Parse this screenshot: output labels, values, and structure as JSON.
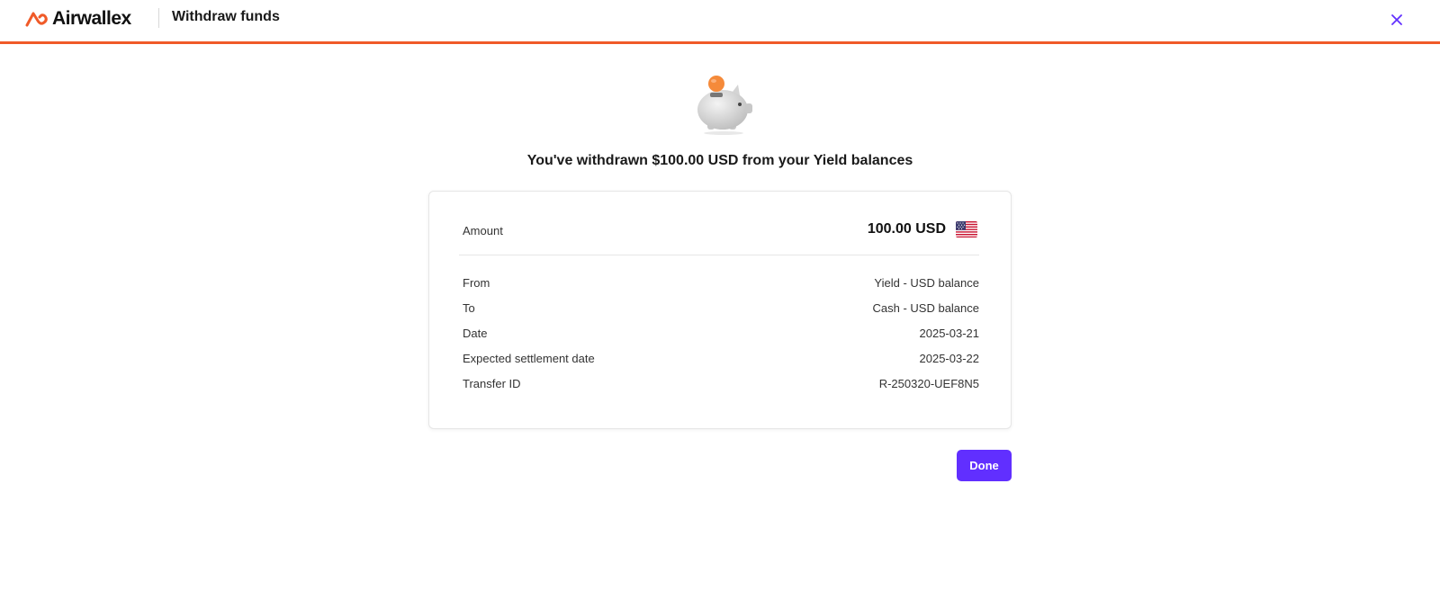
{
  "header": {
    "brand": "Airwallex",
    "title": "Withdraw funds",
    "accent_color": "#f05a28",
    "close_icon": "close-icon"
  },
  "confirmation": {
    "illustration": "piggy-bank-icon",
    "headline": "You've withdrawn $100.00 USD from your Yield balances"
  },
  "summary": {
    "amount_label": "Amount",
    "amount_value": "100.00 USD",
    "currency_flag": "us-flag-icon",
    "rows": [
      {
        "label": "From",
        "value": "Yield - USD balance"
      },
      {
        "label": "To",
        "value": "Cash - USD balance"
      },
      {
        "label": "Date",
        "value": "2025-03-21"
      },
      {
        "label": "Expected settlement date",
        "value": "2025-03-22"
      },
      {
        "label": "Transfer ID",
        "value": "R-250320-UEF8N5"
      }
    ]
  },
  "actions": {
    "done_label": "Done",
    "primary_color": "#612fff"
  }
}
